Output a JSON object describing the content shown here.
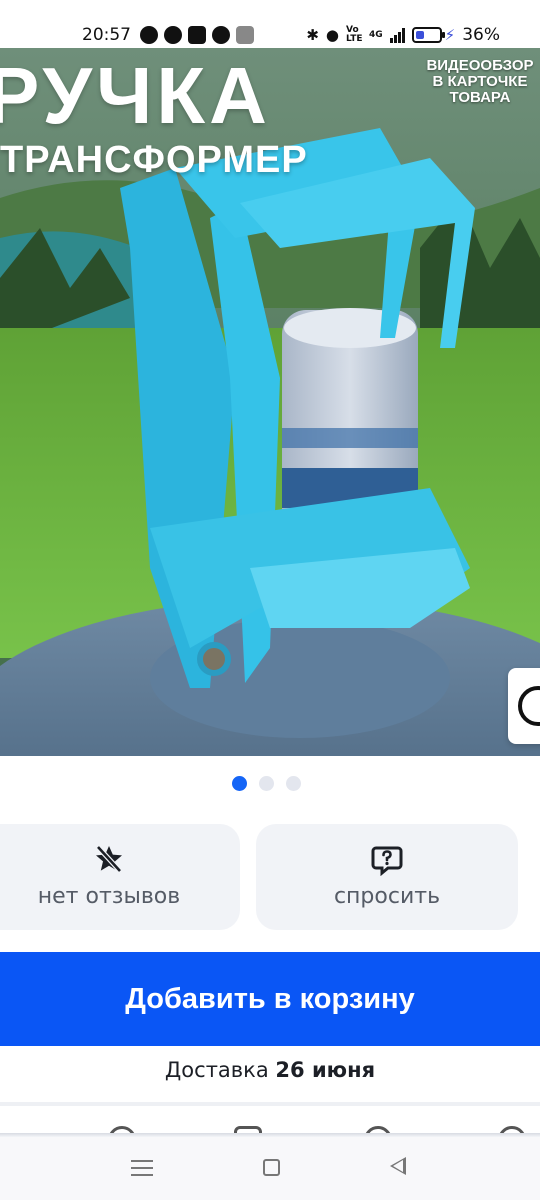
{
  "status_bar": {
    "time": "20:57",
    "network_type": "4G",
    "volte": "Vo LTE",
    "battery_level": 0.36,
    "battery_text": "36%",
    "app_icons": [
      "whatsapp-icon",
      "tiktok-icon",
      "youtube-icon",
      "app-icon",
      "settings-icon"
    ]
  },
  "product_image": {
    "title": "РУЧКА",
    "subtitle": "ТРАНСФОРМЕР",
    "note": "ВИДЕООБЗОР В КАРТОЧКЕ ТОВАРА",
    "slide_count": 3,
    "active_slide": 1
  },
  "actions": {
    "reviews_label": "нет отзывов",
    "ask_label": "спросить"
  },
  "cart": {
    "add_label": "Добавить в корзину",
    "delivery_prefix": "Доставка",
    "delivery_date": "26 июня"
  },
  "colors": {
    "accent": "#0a56f5",
    "dot_active": "#1565f6"
  }
}
